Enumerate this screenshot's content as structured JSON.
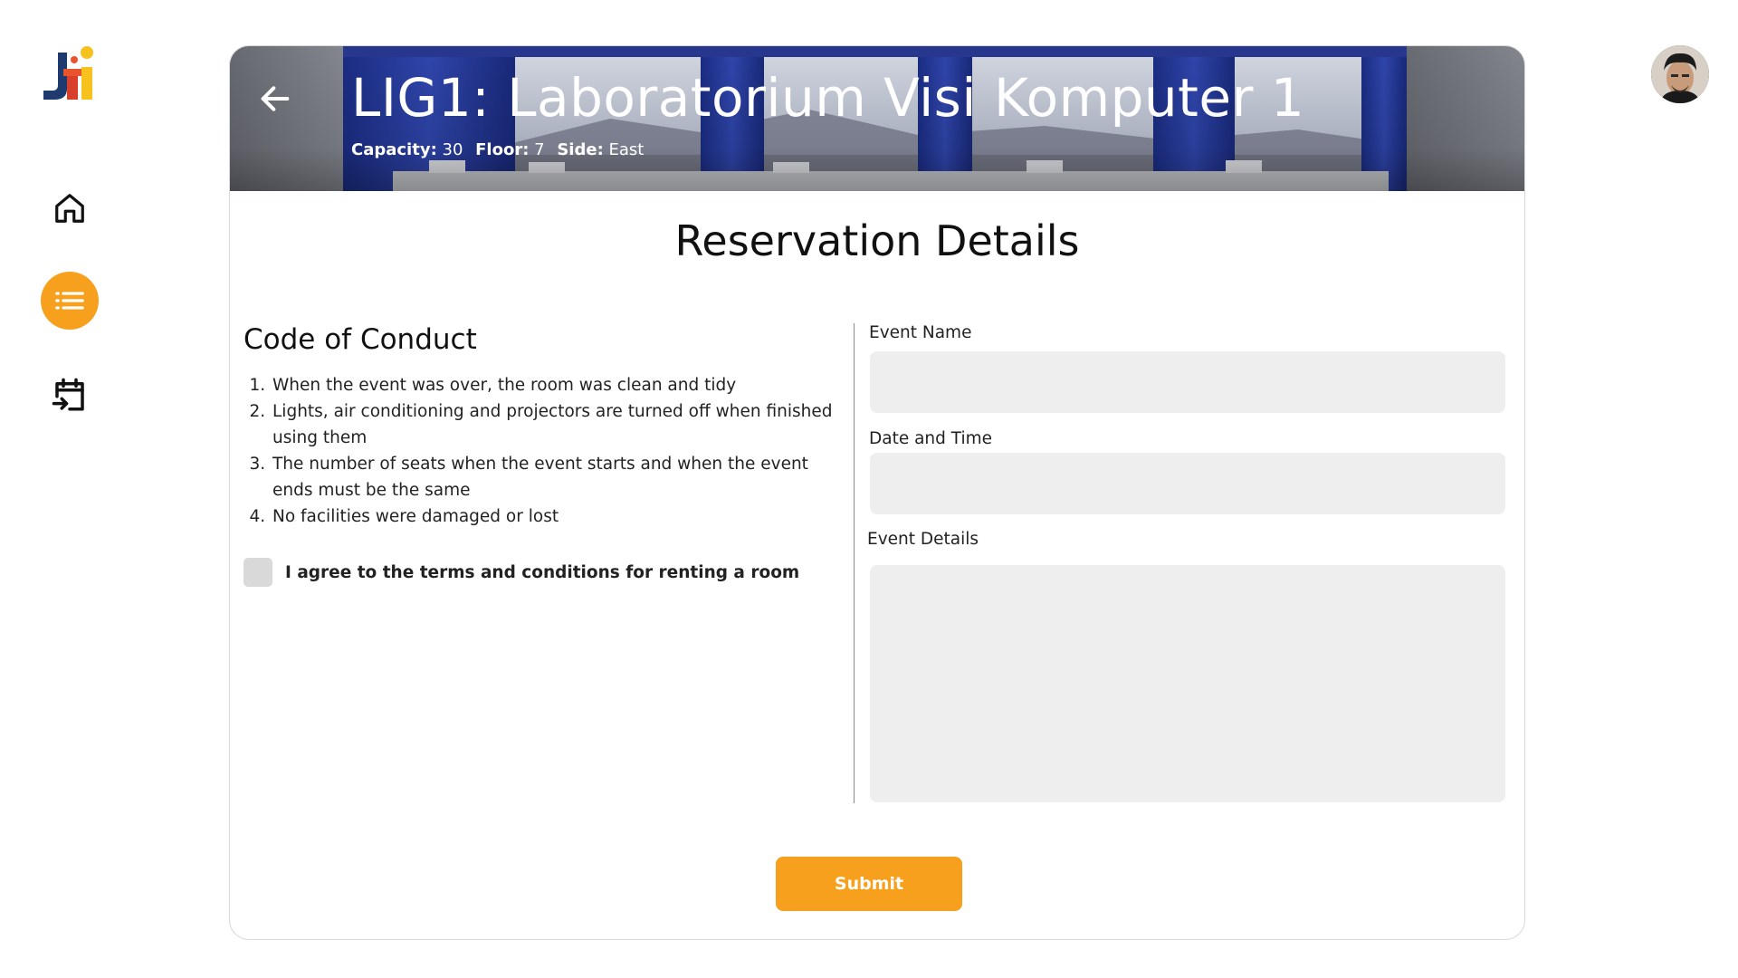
{
  "app": {
    "logo_text": "JTI",
    "colors": {
      "accent": "#F7A01D",
      "logo_blue": "#1E3A6E",
      "logo_red": "#D8402B",
      "logo_yellow": "#F7C21D"
    }
  },
  "sidebar": {
    "items": [
      {
        "name": "home",
        "icon": "home-icon",
        "active": false
      },
      {
        "name": "list",
        "icon": "list-icon",
        "active": true
      },
      {
        "name": "calendar",
        "icon": "calendar-arrow-icon",
        "active": false
      }
    ]
  },
  "room": {
    "title": "LIG1: Laboratorium Visi Komputer 1",
    "capacity_label": "Capacity:",
    "capacity_value": "30",
    "floor_label": "Floor:",
    "floor_value": "7",
    "side_label": "Side:",
    "side_value": "East"
  },
  "page": {
    "title": "Reservation Details"
  },
  "code_of_conduct": {
    "title": "Code of Conduct",
    "rules": [
      "When the event was over, the room was clean and tidy",
      "Lights, air conditioning and projectors are turned off when finished using them",
      "The number of seats when the event starts and when the event ends must be the same",
      "No facilities were damaged or lost"
    ],
    "agree_label": "I agree to the terms and conditions for renting a room",
    "agree_checked": false
  },
  "form": {
    "event_name_label": "Event Name",
    "event_name_value": "",
    "date_time_label": "Date and Time",
    "date_time_value": "",
    "event_details_label": "Event Details",
    "event_details_value": "",
    "submit_label": "Submit"
  }
}
